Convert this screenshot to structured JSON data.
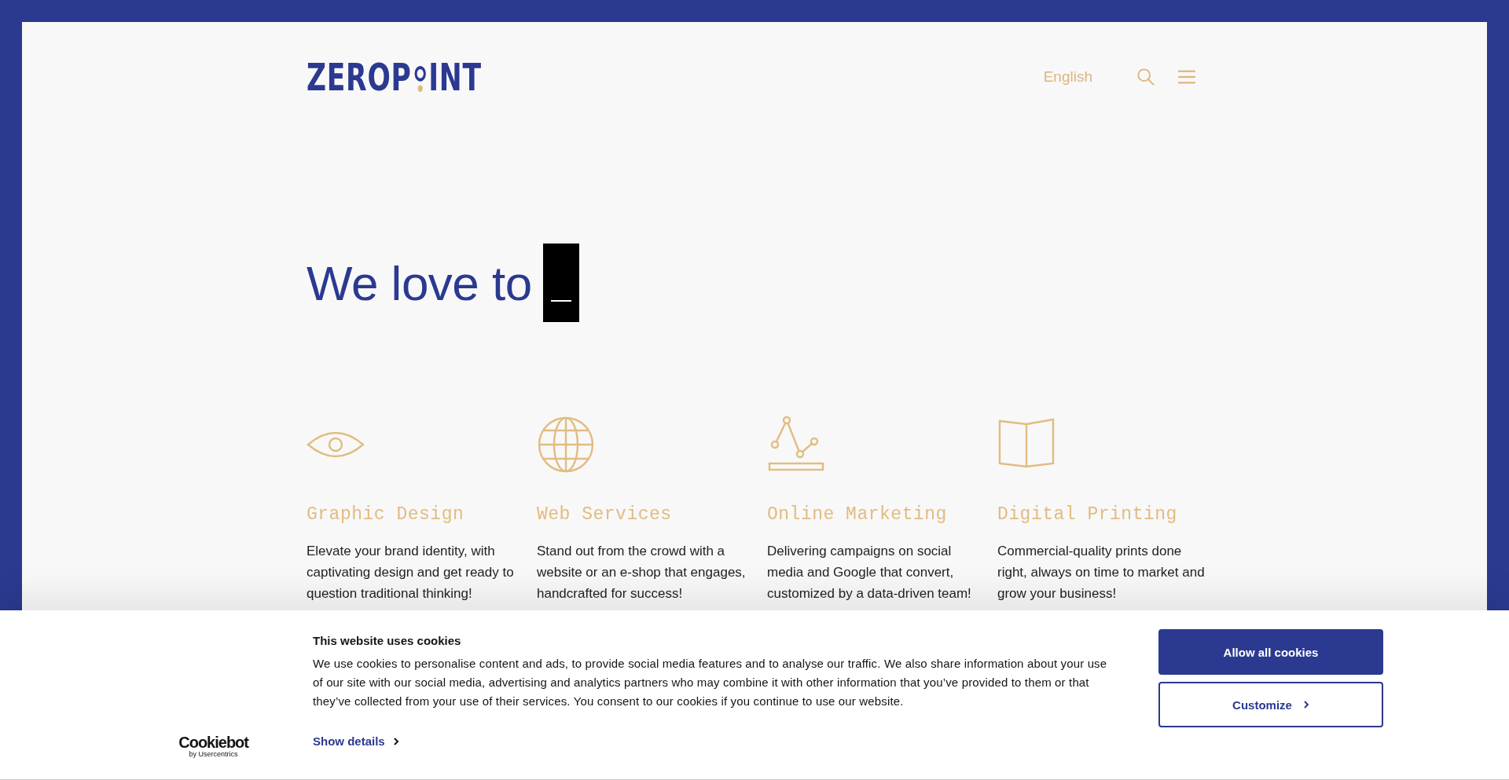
{
  "header": {
    "logo": {
      "before": "ZEROP",
      "after": "INT"
    },
    "language": "English"
  },
  "hero": {
    "headline": "We love to"
  },
  "services": [
    {
      "kind": "eye",
      "title": "Graphic Design",
      "description": "Elevate your brand identity, with captivating design and get ready to question traditional thinking!"
    },
    {
      "kind": "globe",
      "title": "Web Services",
      "description": "Stand out from the crowd with a website or an e-shop that engages, handcrafted for success!"
    },
    {
      "kind": "chart",
      "title": "Online Marketing",
      "description": "Delivering campaigns on social media and Google that convert, customized by a data-driven team!"
    },
    {
      "kind": "map",
      "title": "Digital Printing",
      "description": "Commercial-quality prints done right, always on time to market and grow your business!"
    }
  ],
  "cookie_banner": {
    "brand": "Cookiebot",
    "brand_sub": "by Usercentrics",
    "title": "This website uses cookies",
    "text": "We use cookies to personalise content and ads, to provide social media features and to analyse our traffic. We also share information about your use of our site with our social media, advertising and analytics partners who may combine it with other information that you’ve provided to them or that they’ve collected from your use of their services. You consent to our cookies if you continue to use our website.",
    "details_link": "Show details",
    "buttons": [
      {
        "kind": "primary",
        "label": "Allow all cookies"
      },
      {
        "kind": "secondary",
        "label": "Customize"
      }
    ]
  }
}
